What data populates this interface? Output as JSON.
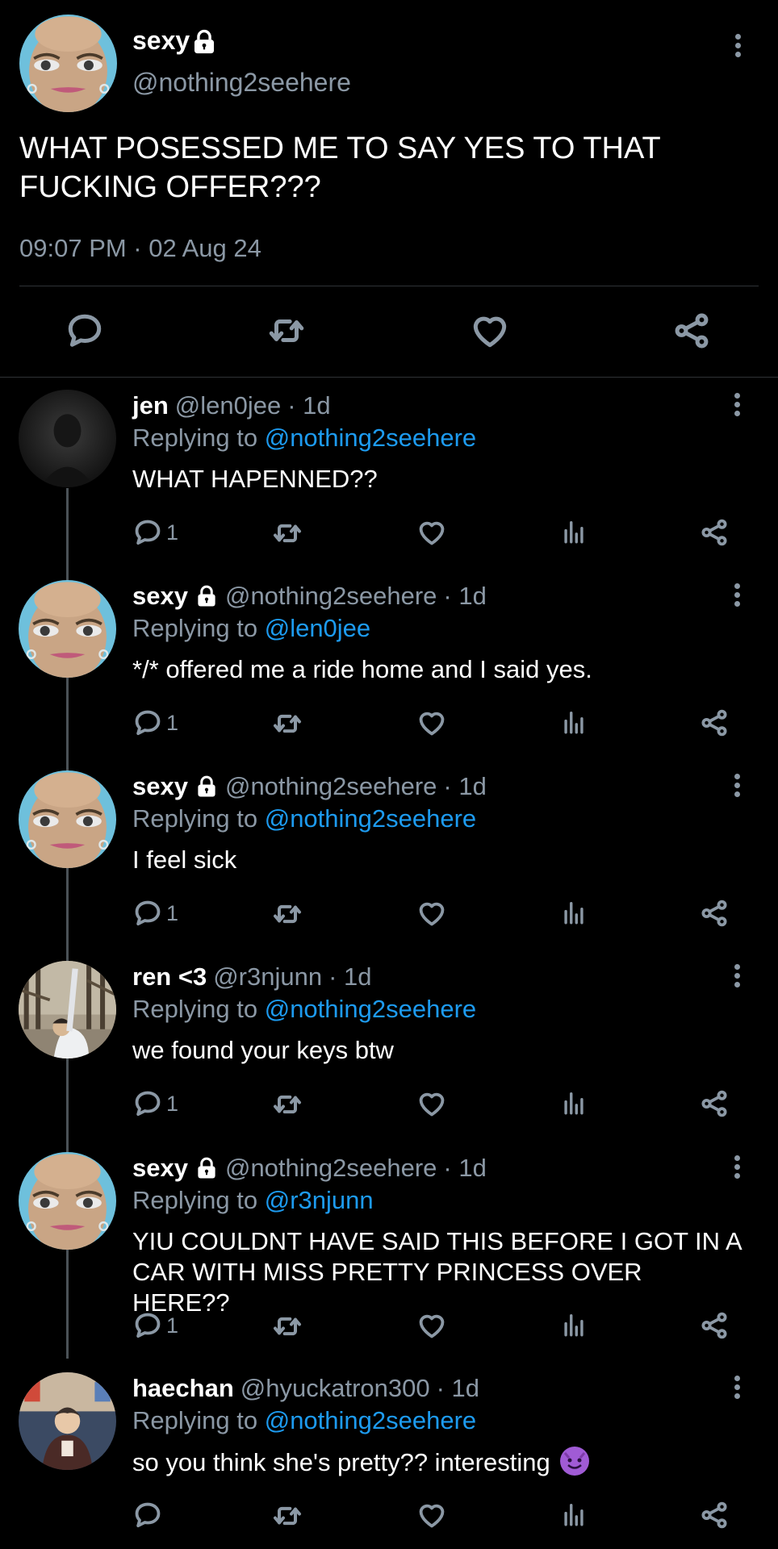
{
  "main_tweet": {
    "name": "sexy",
    "handle": "@nothing2seehere",
    "text": "WHAT POSESSED ME TO SAY YES TO THAT FUCKING OFFER???",
    "timestamp": "09:07 PM · 02 Aug 24",
    "icons": [
      "reply-icon",
      "retweet-icon",
      "like-icon",
      "share-icon"
    ]
  },
  "replies": [
    {
      "name": "jen",
      "locked": false,
      "handle": "@len0jee",
      "time": "· 1d",
      "replying_label": "Replying to",
      "replying_to": "@nothing2seehere",
      "text": "WHAT HAPENNED??",
      "reply_count": "1",
      "avatar": "dark-silhouette"
    },
    {
      "name": "sexy",
      "locked": true,
      "handle": "@nothing2seehere",
      "time": "· 1d",
      "replying_label": "Replying to",
      "replying_to": "@len0jee",
      "text": "*/* offered me a ride home and I said yes.",
      "reply_count": "1",
      "avatar": "cartoon-face"
    },
    {
      "name": "sexy",
      "locked": true,
      "handle": "@nothing2seehere",
      "time": "· 1d",
      "replying_label": "Replying to",
      "replying_to": "@nothing2seehere",
      "text": "I feel sick",
      "reply_count": "1",
      "avatar": "cartoon-face"
    },
    {
      "name": "ren <3",
      "locked": false,
      "handle": "@r3njunn",
      "time": "· 1d",
      "replying_label": "Replying to",
      "replying_to": "@nothing2seehere",
      "text": "we found your keys btw",
      "reply_count": "1",
      "avatar": "outdoor-photo"
    },
    {
      "name": "sexy",
      "locked": true,
      "handle": "@nothing2seehere",
      "time": "· 1d",
      "replying_label": "Replying to",
      "replying_to": "@r3njunn",
      "text": "YIU COULDNT HAVE SAID THIS BEFORE I GOT IN A CAR WITH MISS PRETTY PRINCESS OVER HERE??",
      "reply_count": "1",
      "avatar": "cartoon-face"
    },
    {
      "name": "haechan",
      "locked": false,
      "handle": "@hyuckatron300",
      "time": "· 1d",
      "replying_label": "Replying to",
      "replying_to": "@nothing2seehere",
      "text": "so you think she's pretty?? interesting",
      "emoji": "smiling-devil-emoji",
      "reply_count": "",
      "avatar": "person-photo"
    }
  ],
  "colors": {
    "background": "#000000",
    "muted": "#8b98a5",
    "link": "#1d9bf0",
    "divider": "#2f3336"
  }
}
